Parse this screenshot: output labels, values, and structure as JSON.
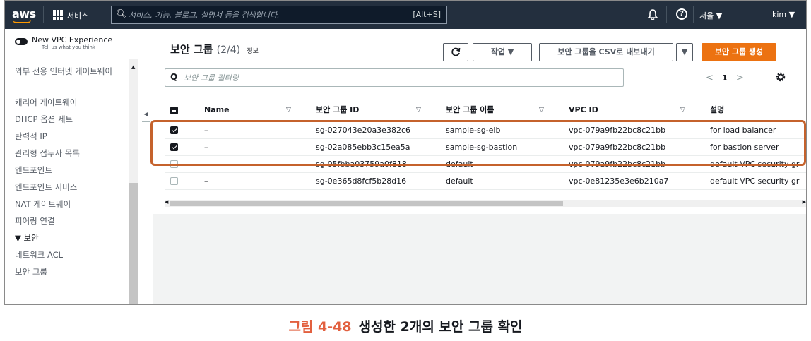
{
  "topnav": {
    "logo": "aws",
    "services": "서비스",
    "search_placeholder": "서비스, 기능, 블로그, 설명서 등을 검색합니다.",
    "search_shortcut": "[Alt+S]",
    "region": "서울 ▼",
    "user": "kim ▼"
  },
  "sidebar": {
    "vpc_experience": "New VPC Experience",
    "vpc_experience_sub": "Tell us what you think",
    "cut_item": "외부 전용 인터넷 게이트웨이",
    "items": [
      "캐리어 게이트웨이",
      "DHCP 옵션 세트",
      "탄력적 IP",
      "관리형 접두사 목록",
      "엔드포인트",
      "엔드포인트 서비스",
      "NAT 게이트웨이",
      "피어링 연결"
    ],
    "section": "▼ 보안",
    "section_items": [
      "네트워크 ACL",
      "보안 그룹"
    ]
  },
  "main": {
    "title": "보안 그룹",
    "count": "(2/4)",
    "info": "정보",
    "refresh_icon": "refresh-icon",
    "actions_label": "작업 ▼",
    "export_label": "보안 그룹을 CSV로 내보내기",
    "export_dropdown": "▼",
    "create_label": "보안 그룹 생성",
    "filter_placeholder": "보안 그룹 필터링",
    "pager_prev": "<",
    "pager_page": "1",
    "pager_next": ">"
  },
  "table": {
    "headers": [
      "Name",
      "보안 그룹 ID",
      "보안 그룹 이름",
      "VPC ID",
      "설명"
    ],
    "rows": [
      {
        "checked": true,
        "name": "–",
        "id": "sg-027043e20a3e382c6",
        "group_name": "sample-sg-elb",
        "vpc": "vpc-079a9fb22bc8c21bb",
        "desc": "for load balancer"
      },
      {
        "checked": true,
        "name": "–",
        "id": "sg-02a085ebb3c15ea5a",
        "group_name": "sample-sg-bastion",
        "vpc": "vpc-079a9fb22bc8c21bb",
        "desc": "for bastion server"
      },
      {
        "checked": false,
        "name": "–",
        "id": "sg-05fbba03759a0f818",
        "group_name": "default",
        "vpc": "vpc-079a9fb22bc8c21bb",
        "desc": "default VPC security gr"
      },
      {
        "checked": false,
        "name": "–",
        "id": "sg-0e365d8fcf5b28d16",
        "group_name": "default",
        "vpc": "vpc-0e81235e3e6b210a7",
        "desc": "default VPC security gr"
      }
    ]
  },
  "caption": {
    "figure": "그림 4-48",
    "text": "생성한 2개의 보안 그룹 확인"
  },
  "colors": {
    "nav_bg": "#232f3e",
    "primary": "#ec7211",
    "highlight": "#c5622c",
    "caption_accent": "#e2603f"
  }
}
